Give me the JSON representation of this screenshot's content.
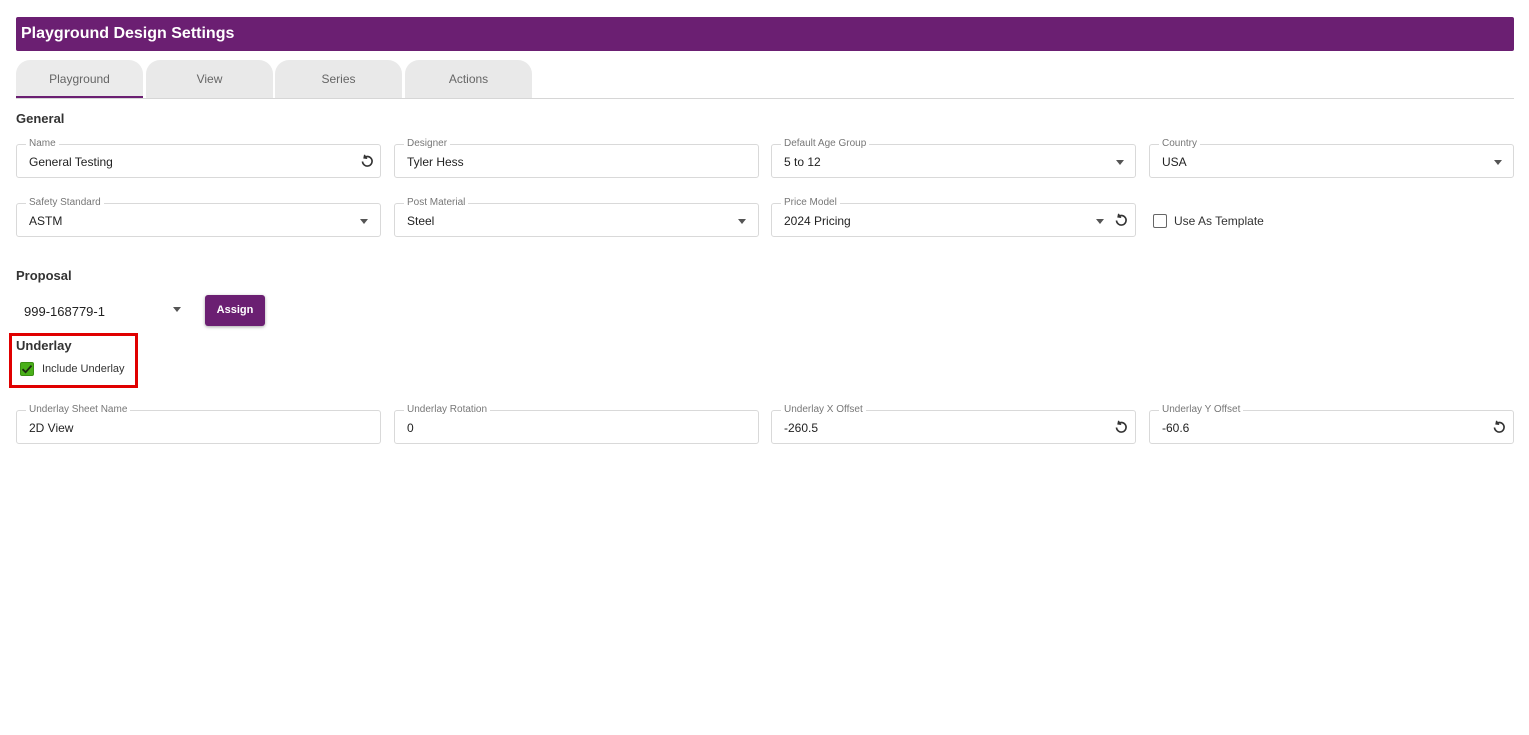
{
  "header": {
    "title": "Playground Design Settings"
  },
  "tabs": [
    {
      "label": "Playground",
      "active": true
    },
    {
      "label": "View",
      "active": false
    },
    {
      "label": "Series",
      "active": false
    },
    {
      "label": "Actions",
      "active": false
    }
  ],
  "general": {
    "title": "General",
    "name": {
      "label": "Name",
      "value": "General Testing"
    },
    "designer": {
      "label": "Designer",
      "value": "Tyler Hess"
    },
    "age_group": {
      "label": "Default Age Group",
      "value": "5 to 12"
    },
    "country": {
      "label": "Country",
      "value": "USA"
    },
    "safety_standard": {
      "label": "Safety Standard",
      "value": "ASTM"
    },
    "post_material": {
      "label": "Post Material",
      "value": "Steel"
    },
    "price_model": {
      "label": "Price Model",
      "value": "2024 Pricing"
    },
    "use_as_template": {
      "label": "Use As Template",
      "checked": false
    }
  },
  "proposal": {
    "title": "Proposal",
    "value": "999-168779-1",
    "assign_label": "Assign"
  },
  "underlay": {
    "title": "Underlay",
    "include": {
      "label": "Include Underlay",
      "checked": true
    },
    "sheet_name": {
      "label": "Underlay Sheet Name",
      "value": "2D View"
    },
    "rotation": {
      "label": "Underlay Rotation",
      "value": "0"
    },
    "x_offset": {
      "label": "Underlay X Offset",
      "value": "-260.5"
    },
    "y_offset": {
      "label": "Underlay Y Offset",
      "value": "-60.6"
    }
  },
  "colors": {
    "brand": "#6b1f72",
    "check": "#4ab01a",
    "highlight": "#e00000"
  },
  "icons": [
    "reset-icon",
    "caret-down-icon",
    "check-icon"
  ]
}
